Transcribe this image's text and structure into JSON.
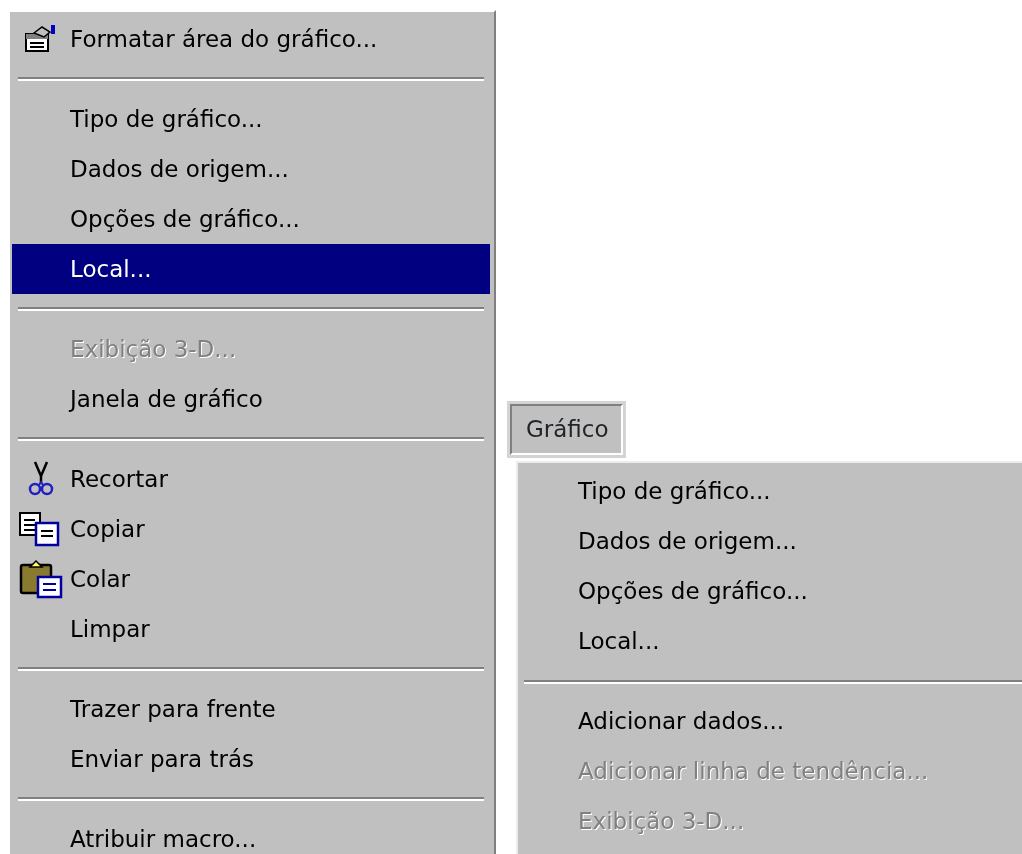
{
  "context_menu": {
    "items": [
      {
        "kind": "format",
        "label": "Formatar área do gráfico...",
        "disabled": false,
        "selected": false
      },
      {
        "kind": "separator"
      },
      {
        "kind": "plain",
        "label": "Tipo de gráfico...",
        "disabled": false,
        "selected": false
      },
      {
        "kind": "plain",
        "label": "Dados de origem...",
        "disabled": false,
        "selected": false
      },
      {
        "kind": "plain",
        "label": "Opções de gráfico...",
        "disabled": false,
        "selected": false
      },
      {
        "kind": "plain",
        "label": "Local...",
        "disabled": false,
        "selected": true
      },
      {
        "kind": "separator"
      },
      {
        "kind": "plain",
        "label": "Exibição 3-D...",
        "disabled": true,
        "selected": false
      },
      {
        "kind": "plain",
        "label": "Janela de gráfico",
        "disabled": false,
        "selected": false
      },
      {
        "kind": "separator"
      },
      {
        "kind": "cut",
        "label": "Recortar",
        "disabled": false,
        "selected": false
      },
      {
        "kind": "copy",
        "label": "Copiar",
        "disabled": false,
        "selected": false
      },
      {
        "kind": "paste",
        "label": "Colar",
        "disabled": false,
        "selected": false
      },
      {
        "kind": "plain",
        "label": "Limpar",
        "disabled": false,
        "selected": false
      },
      {
        "kind": "separator"
      },
      {
        "kind": "plain",
        "label": "Trazer para frente",
        "disabled": false,
        "selected": false
      },
      {
        "kind": "plain",
        "label": "Enviar para trás",
        "disabled": false,
        "selected": false
      },
      {
        "kind": "separator"
      },
      {
        "kind": "plain",
        "label": "Atribuir macro...",
        "disabled": false,
        "selected": false
      }
    ]
  },
  "menu_bar": {
    "items": [
      {
        "label": "Gráfico",
        "selected": true
      }
    ]
  },
  "chart_menu": {
    "items": [
      {
        "kind": "plain",
        "label": "Tipo de gráfico...",
        "disabled": false,
        "selected": false
      },
      {
        "kind": "plain",
        "label": "Dados de origem...",
        "disabled": false,
        "selected": false
      },
      {
        "kind": "plain",
        "label": "Opções de gráfico...",
        "disabled": false,
        "selected": false
      },
      {
        "kind": "plain",
        "label": "Local...",
        "disabled": false,
        "selected": false
      },
      {
        "kind": "separator"
      },
      {
        "kind": "plain",
        "label": "Adicionar dados...",
        "disabled": false,
        "selected": false
      },
      {
        "kind": "plain",
        "label": "Adicionar linha de tendência...",
        "disabled": true,
        "selected": false
      },
      {
        "kind": "plain",
        "label": "Exibição 3-D...",
        "disabled": true,
        "selected": false
      }
    ]
  }
}
